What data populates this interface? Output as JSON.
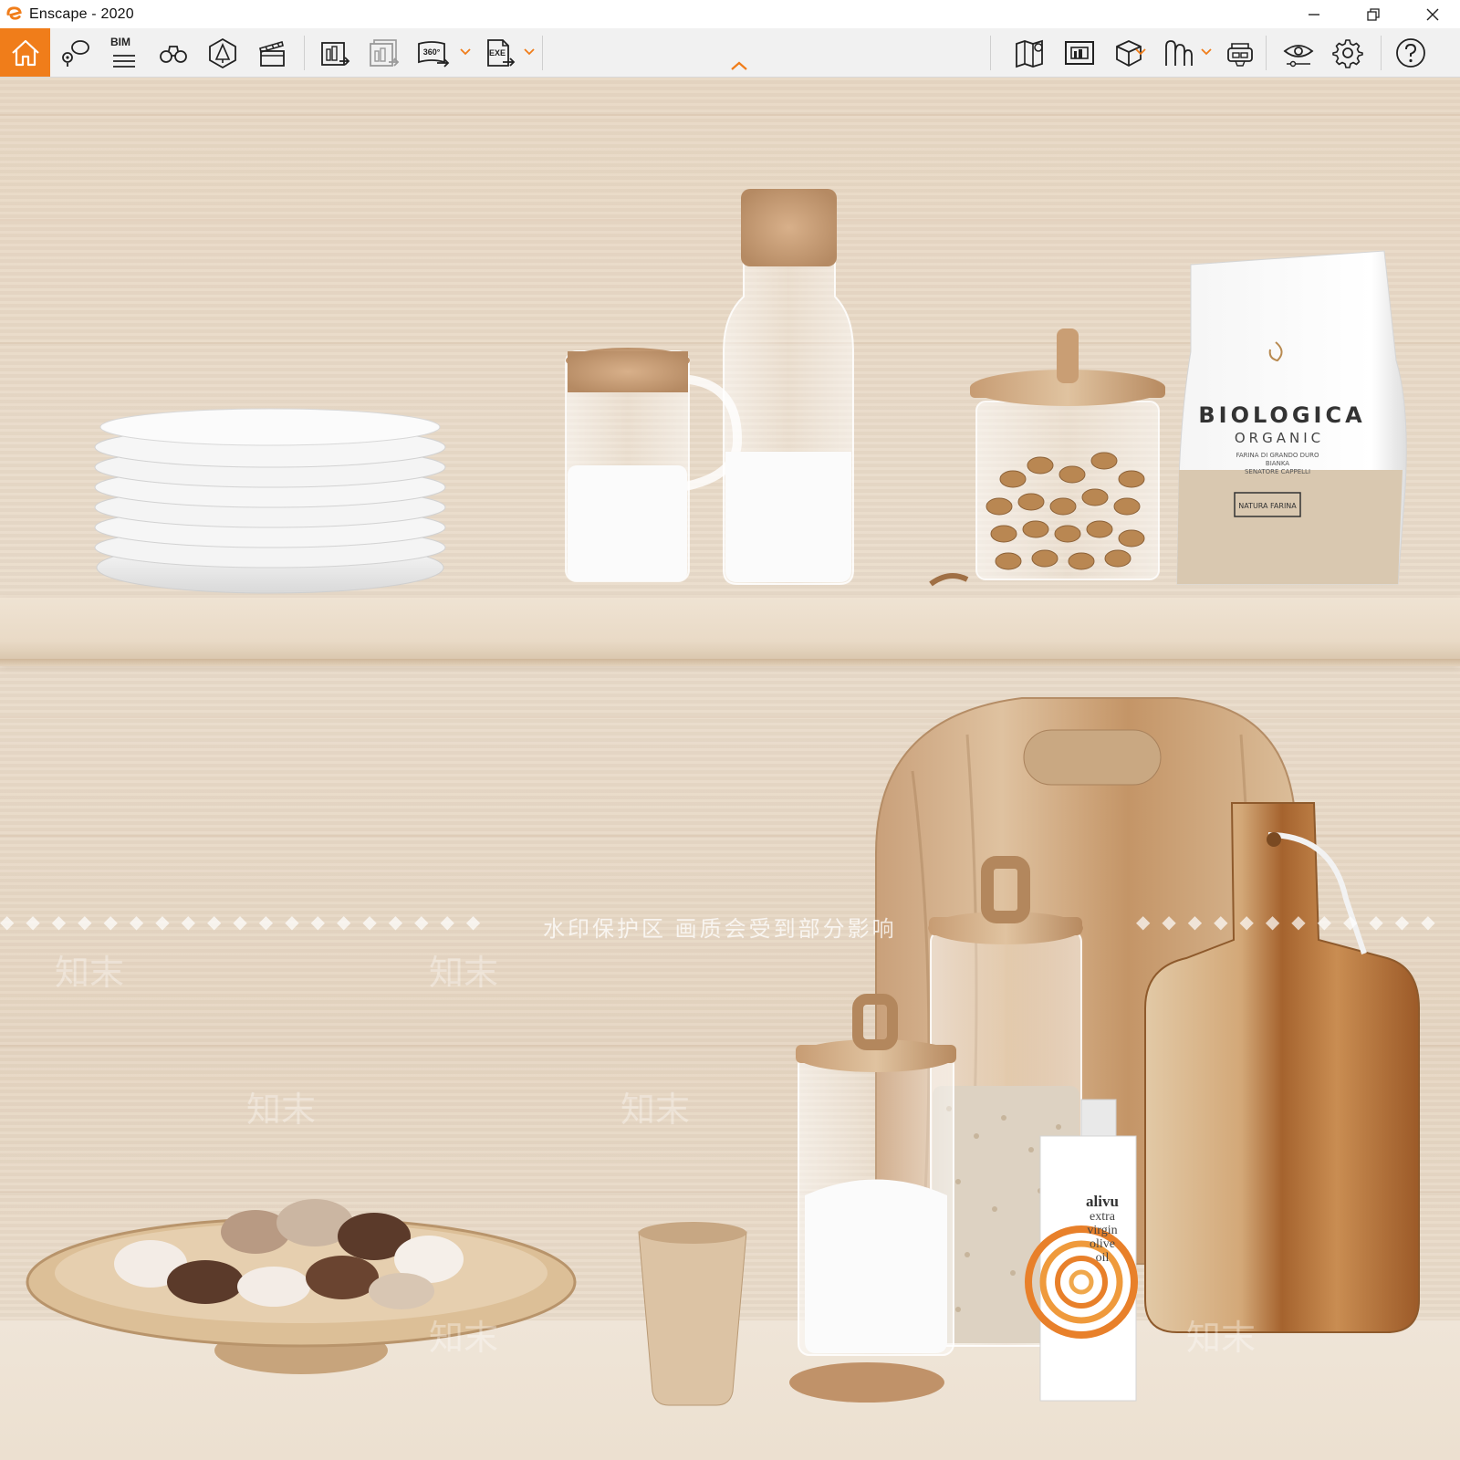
{
  "window": {
    "title": "Enscape - 2020",
    "minimize_glyph": "—",
    "restore_glyph": "❐",
    "close_glyph": "✕"
  },
  "toolbar": {
    "bim_label": "BIM",
    "left_buttons": [
      "home-icon",
      "views-icon",
      "bim-icon",
      "binoculars-icon",
      "asset-library-icon",
      "video-editor-icon"
    ],
    "export_buttons": [
      "screenshot-export-icon",
      "batch-render-icon",
      "panorama-360-icon",
      "exe-export-icon"
    ],
    "panorama_label": "360°",
    "exe_label": "EXE",
    "right_buttons": [
      "map-icon",
      "render-view-icon",
      "cube-icon",
      "material-icon",
      "vr-headset-icon",
      "visual-settings-icon",
      "settings-icon",
      "help-icon"
    ],
    "accent_color": "#f07d1a"
  },
  "viewport": {
    "watermark": "水印保护区  画质会受到部分影响",
    "watermark_marks": [
      "知末",
      "知末",
      "知末",
      "知末",
      "知末",
      "知末"
    ],
    "flour_bag": {
      "brand": "BIOLOGICA",
      "subtitle": "ORGANIC",
      "line1": "FARINA DI GRANDO DURO",
      "line2": "BIANKA",
      "line3": "SENATORE CAPPELLI",
      "badge": "NATURA FARINA"
    },
    "oil_bottle": {
      "brand": "alivu",
      "line1": "extra",
      "line2": "virgin",
      "line3": "olive",
      "line4": "oil"
    }
  }
}
